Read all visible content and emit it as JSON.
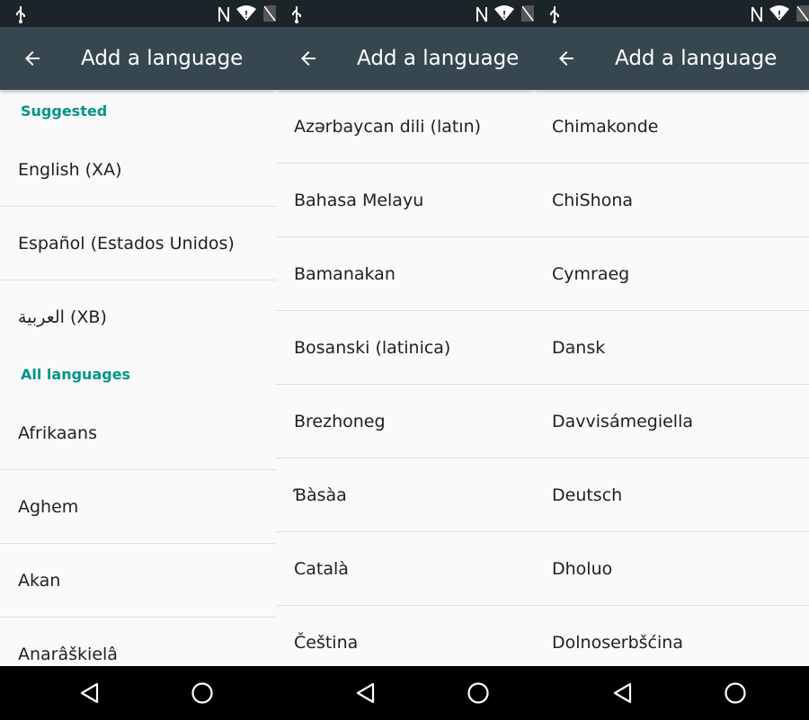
{
  "app_title": "Add a language",
  "panels": [
    {
      "rows": [
        {
          "type": "header",
          "text": "Suggested"
        },
        {
          "type": "item",
          "text": "English (XA)"
        },
        {
          "type": "item",
          "text": "Español (Estados Unidos)"
        },
        {
          "type": "item",
          "text": "العربية (XB)"
        },
        {
          "type": "header",
          "text": "All languages"
        },
        {
          "type": "item",
          "text": "Afrikaans"
        },
        {
          "type": "item",
          "text": "Aghem"
        },
        {
          "type": "item",
          "text": "Akan"
        },
        {
          "type": "item",
          "text": "Anarâškielâ"
        }
      ]
    },
    {
      "rows": [
        {
          "type": "item",
          "text": "Azərbaycan dili (latın)"
        },
        {
          "type": "item",
          "text": "Bahasa Melayu"
        },
        {
          "type": "item",
          "text": "Bamanakan"
        },
        {
          "type": "item",
          "text": "Bosanski (latinica)"
        },
        {
          "type": "item",
          "text": "Brezhoneg"
        },
        {
          "type": "item",
          "text": "Ɓàsàa"
        },
        {
          "type": "item",
          "text": "Català"
        },
        {
          "type": "item",
          "text": "Čeština"
        }
      ]
    },
    {
      "rows": [
        {
          "type": "item",
          "text": "Chimakonde"
        },
        {
          "type": "item",
          "text": "ChiShona"
        },
        {
          "type": "item",
          "text": "Cymraeg"
        },
        {
          "type": "item",
          "text": "Dansk"
        },
        {
          "type": "item",
          "text": "Davvisámegiella"
        },
        {
          "type": "item",
          "text": "Deutsch"
        },
        {
          "type": "item",
          "text": "Dholuo"
        },
        {
          "type": "item",
          "text": "Dolnoserbšćina"
        }
      ]
    }
  ],
  "status_icons": [
    "usb-icon",
    "nfc-icon",
    "wifi-icon",
    "no-sim-icon"
  ],
  "nav_icons": [
    "back-triangle-icon",
    "home-circle-icon"
  ],
  "colors": {
    "status_bar": "#1b2429",
    "app_bar": "#37474f",
    "section_header": "#009688",
    "list_background": "#fafafa",
    "divider": "#e0e0e0",
    "text": "#212121"
  }
}
